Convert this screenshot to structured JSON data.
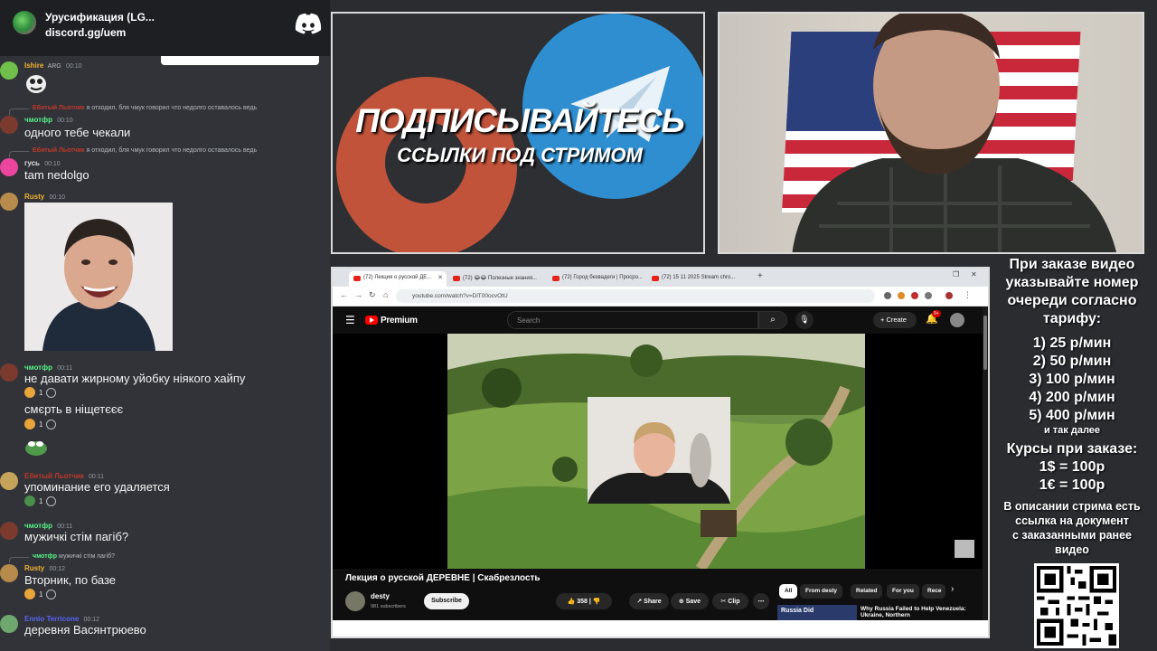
{
  "invite": {
    "server_name": "Урусификация (LG...",
    "link": "discord.gg/uem"
  },
  "chat": {
    "messages": [
      {
        "user": "Ishire",
        "user_color": "#f0b232",
        "badge": "ARG",
        "time": "00:10",
        "text": ""
      },
      {
        "reply_user": "Ебитый Льотчик",
        "reply_text": "я отходил, бля чмук говорил что недолго оставалось ведь",
        "user": "чмотфр",
        "user_color": "#57f287",
        "time": "00:10",
        "text": "одного тебе чекали"
      },
      {
        "reply_user": "Ебитый Льотчик",
        "reply_text": "я отходил, бля чмук говорил что недолго оставалось ведь",
        "user": "гусь",
        "user_color": "#dbdee1",
        "time": "00:10",
        "text": "tam nedolgo"
      },
      {
        "user": "Rusty",
        "user_color": "#f0b232",
        "time": "00:10",
        "text": ""
      },
      {
        "user": "чмотфр",
        "user_color": "#57f287",
        "time": "00:11",
        "text": "не давати жирному уйобку ніякого хайпу",
        "reaction_count": "1"
      },
      {
        "text": "смєрть в ніщетєєє",
        "reaction_count": "1"
      },
      {
        "user": "Ебитый Льотчик",
        "user_color": "#c0392b",
        "time": "00:11",
        "text": "упоминание его удаляется",
        "reaction_count": "1"
      },
      {
        "user": "чмотфр",
        "user_color": "#57f287",
        "time": "00:11",
        "text": "мужичкі стім пагіб?"
      },
      {
        "reply_user": "чмотфр",
        "reply_text": "мужичкі стім пагіб?",
        "user": "Rusty",
        "user_color": "#f0b232",
        "time": "00:12",
        "text": "Вторник, по базе",
        "reaction_count": "1"
      },
      {
        "user": "Ennio Terricone",
        "user_color": "#5865f2",
        "time": "00:12",
        "text": "деревня Васянтрюево"
      }
    ]
  },
  "promo": {
    "line1": "ПОДПИСЫВАЙТЕСЬ",
    "line2": "ССЫЛКИ ПОД СТРИМОМ"
  },
  "info": {
    "heading": [
      "При заказе видео",
      "указывайте номер",
      "очереди согласно",
      "тарифу:"
    ],
    "tariffs": [
      "1) 25 р/мин",
      "2) 50 р/мин",
      "3) 100 р/мин",
      "4) 200 р/мин",
      "5) 400 р/мин"
    ],
    "etc": "и так далее",
    "rates_title": "Курсы при заказе:",
    "rates": [
      "1$ = 100р",
      "1€ = 100р"
    ],
    "note": [
      "В описании стрима есть",
      "ссылка на документ",
      "с заказанными ранее",
      "видео"
    ]
  },
  "browser": {
    "tabs": [
      {
        "title": "(72) Лекция о русской ДЕ..."
      },
      {
        "title": "(72) 😂😂 Полезные знания..."
      },
      {
        "title": "(72) Город безвадеги | Просро..."
      },
      {
        "title": "(72) 15 11 2025 Stream chro..."
      }
    ],
    "url": "youtube.com/watch?v=DiT00ocvOtU"
  },
  "youtube": {
    "brand": "Premium",
    "search_placeholder": "Search",
    "create_label": "Create",
    "notif_count": "9+",
    "video_title": "Лекция о русской ДЕРЕВНЕ | Скабрезлость",
    "channel": "desty",
    "subscribers": "981 subscribers",
    "subscribe_label": "Subscribe",
    "likes": "358",
    "share_label": "Share",
    "save_label": "Save",
    "clip_label": "Clip",
    "chips": [
      "All",
      "From desty",
      "Related",
      "For you",
      "Rece"
    ],
    "rec_title": "Why Russia Failed to Help Venezuela: Ukraine, Northern",
    "rec_thumb_text": "Russia Did"
  },
  "colors": {
    "discord_bg": "#313338",
    "telegram_blue": "#2f8ed0",
    "patreon_orange": "#c0533a",
    "yt_red": "#ff0000"
  }
}
